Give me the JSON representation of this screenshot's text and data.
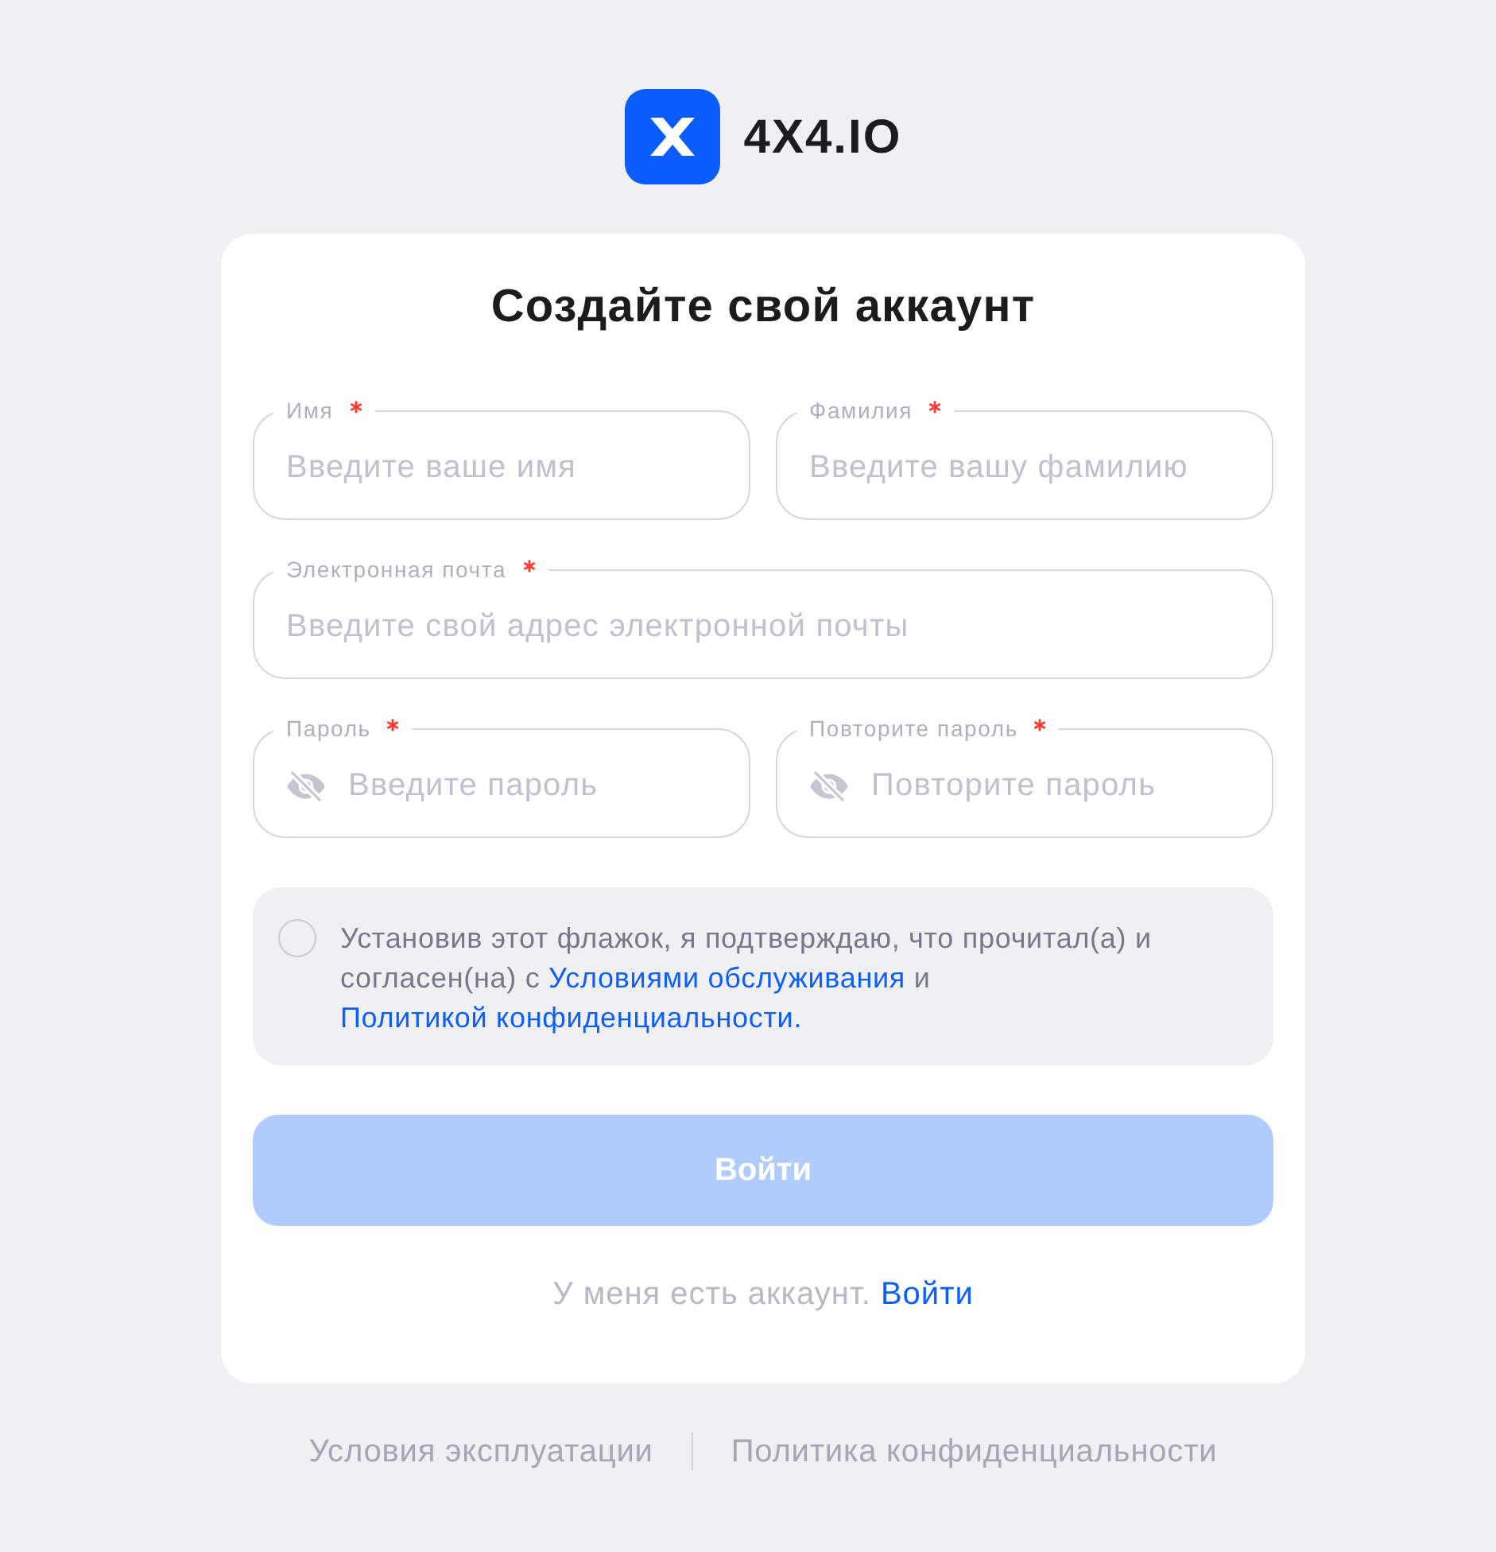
{
  "logo": {
    "text": "4X4.IO"
  },
  "title": "Создайте свой аккаунт",
  "field_rows": [
    [
      {
        "kind": "text",
        "label": "Имя",
        "required": true,
        "placeholder": "Введите ваше имя"
      },
      {
        "kind": "text",
        "label": "Фамилия",
        "required": true,
        "placeholder": "Введите вашу фамилию"
      }
    ],
    [
      {
        "kind": "text",
        "label": "Электронная почта",
        "required": true,
        "placeholder": "Введите свой адрес электронной почты"
      }
    ],
    [
      {
        "kind": "password",
        "label": "Пароль",
        "required": true,
        "placeholder": "Введите пароль"
      },
      {
        "kind": "password",
        "label": "Повторите пароль",
        "required": true,
        "placeholder": "Повторите пароль"
      }
    ]
  ],
  "consent": {
    "checked": false,
    "parts": [
      {
        "kind": "text",
        "text": "Установив этот флажок, я подтверждаю, что прочитал(а) и согласен(на) с "
      },
      {
        "kind": "link",
        "text": "Условиями обслуживания"
      },
      {
        "kind": "text",
        "text": " и "
      },
      {
        "kind": "link",
        "text": "Политикой конфиденциальности."
      }
    ]
  },
  "submit": {
    "label": "Войти",
    "disabled": true
  },
  "signin_prompt": {
    "text": "У меня есть аккаунт.",
    "link": "Войти"
  },
  "footer_links": [
    "Условия эксплуатации",
    "Политика конфиденциальности"
  ]
}
